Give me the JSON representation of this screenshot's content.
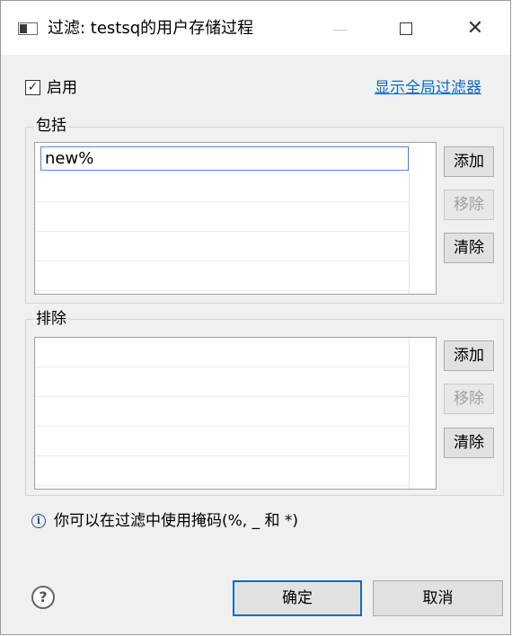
{
  "window": {
    "title": "过滤: testsq的用户存储过程",
    "controls": {
      "minimize": "—",
      "maximize": "☐",
      "close": "✕"
    }
  },
  "enable": {
    "label": "启用",
    "checked": true,
    "check_glyph": "✓"
  },
  "global_filter_link": "显示全局过滤器",
  "include": {
    "label": "包括",
    "items": [
      "new%"
    ],
    "buttons": {
      "add": "添加",
      "remove": "移除",
      "clear": "清除"
    },
    "remove_enabled": false
  },
  "exclude": {
    "label": "排除",
    "items": [],
    "buttons": {
      "add": "添加",
      "remove": "移除",
      "clear": "清除"
    },
    "remove_enabled": false
  },
  "info": {
    "icon": "info-icon",
    "text": "你可以在过滤中使用掩码(%, _ 和 *)",
    "glyph": "i"
  },
  "footer": {
    "help_glyph": "?",
    "ok": "确定",
    "cancel": "取消"
  },
  "colors": {
    "accent": "#0a6bc9",
    "window_bg": "#f0f0f0",
    "button_bg": "#e1e1e1",
    "disabled_text": "#a0a0a0"
  }
}
